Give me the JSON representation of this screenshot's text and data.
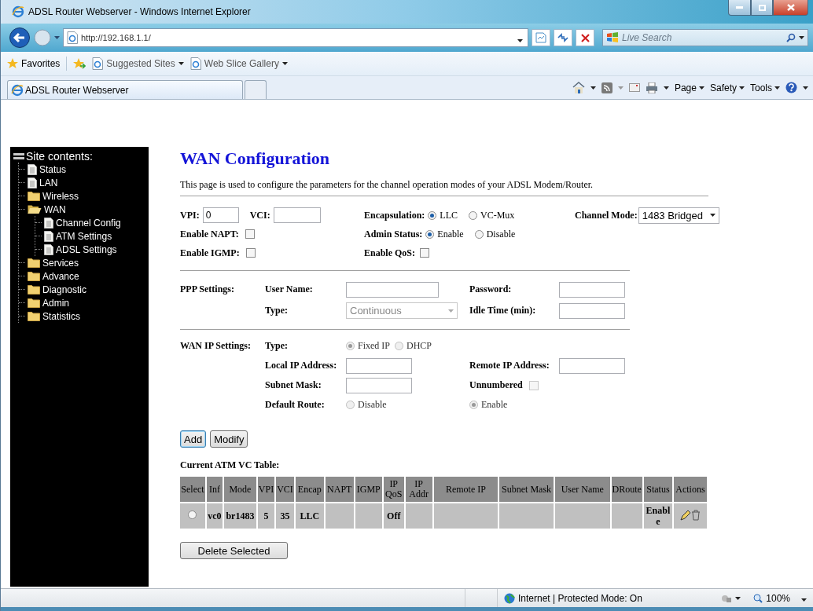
{
  "window": {
    "title": "ADSL Router Webserver - Windows Internet Explorer"
  },
  "address_bar": {
    "url": "http://192.168.1.1/"
  },
  "search": {
    "placeholder": "Live Search"
  },
  "favorites_bar": {
    "items": [
      {
        "label": "Favorites",
        "kind": "favorites"
      },
      {
        "label": "Suggested Sites",
        "kind": "link"
      },
      {
        "label": "Web Slice Gallery",
        "kind": "link"
      }
    ]
  },
  "tabs": [
    {
      "label": "ADSL Router Webserver",
      "selected": true
    }
  ],
  "command_bar": {
    "menus": [
      "Page",
      "Safety",
      "Tools"
    ]
  },
  "sidebar": {
    "title": "Site contents:",
    "items": [
      {
        "label": "Status",
        "kind": "page"
      },
      {
        "label": "LAN",
        "kind": "page"
      },
      {
        "label": "Wireless",
        "kind": "folder",
        "expanded": false
      },
      {
        "label": "WAN",
        "kind": "folder",
        "expanded": true,
        "children": [
          {
            "label": "Channel Config",
            "kind": "page"
          },
          {
            "label": "ATM Settings",
            "kind": "page"
          },
          {
            "label": "ADSL Settings",
            "kind": "page"
          }
        ]
      },
      {
        "label": "Services",
        "kind": "folder",
        "expanded": false
      },
      {
        "label": "Advance",
        "kind": "folder",
        "expanded": false
      },
      {
        "label": "Diagnostic",
        "kind": "folder",
        "expanded": false
      },
      {
        "label": "Admin",
        "kind": "folder",
        "expanded": false
      },
      {
        "label": "Statistics",
        "kind": "folder",
        "expanded": false
      }
    ]
  },
  "page": {
    "title": "WAN Configuration",
    "description": "This page is used to configure the parameters for the channel operation modes of your ADSL Modem/Router."
  },
  "form": {
    "vpi": {
      "label": "VPI:",
      "value": "0"
    },
    "vci": {
      "label": "VCI:"
    },
    "encapsulation": {
      "label": "Encapsulation:",
      "options": [
        {
          "label": "LLC",
          "selected": true
        },
        {
          "label": "VC-Mux",
          "selected": false
        }
      ]
    },
    "channel_mode": {
      "label": "Channel Mode:",
      "value": "1483 Bridged"
    },
    "enable_napt": {
      "label": "Enable NAPT:",
      "checked": false
    },
    "admin_status": {
      "label": "Admin Status:",
      "options": [
        {
          "label": "Enable",
          "selected": true
        },
        {
          "label": "Disable",
          "selected": false
        }
      ]
    },
    "enable_igmp": {
      "label": "Enable IGMP:",
      "checked": false
    },
    "enable_qos": {
      "label": "Enable QoS:",
      "checked": false
    }
  },
  "ppp": {
    "label": "PPP Settings:",
    "user_name": {
      "label": "User Name:"
    },
    "password": {
      "label": "Password:"
    },
    "type": {
      "label": "Type:",
      "value": "Continuous",
      "disabled": true
    },
    "idle_time": {
      "label": "Idle Time (min):"
    }
  },
  "wan_ip": {
    "label": "WAN IP Settings:",
    "disabled": true,
    "type": {
      "label": "Type:",
      "options": [
        {
          "label": "Fixed IP",
          "selected": true
        },
        {
          "label": "DHCP",
          "selected": false
        }
      ]
    },
    "local_ip": {
      "label": "Local IP Address:"
    },
    "remote_ip": {
      "label": "Remote IP Address:"
    },
    "subnet_mask": {
      "label": "Subnet Mask:"
    },
    "unnumbered": {
      "label": "Unnumbered",
      "checked": false
    },
    "default_route": {
      "label": "Default Route:",
      "options": [
        {
          "label": "Disable",
          "selected": false
        },
        {
          "label": "Enable",
          "selected": true
        }
      ]
    }
  },
  "buttons": [
    {
      "label": "Add",
      "focused": true
    },
    {
      "label": "Modify",
      "focused": false
    }
  ],
  "table": {
    "title": "Current ATM VC Table:",
    "columns": [
      {
        "kind": "select",
        "label": "Select"
      },
      {
        "kind": "text",
        "label": "Inf"
      },
      {
        "kind": "text",
        "label": "Mode"
      },
      {
        "kind": "text",
        "label": "VPI"
      },
      {
        "kind": "text",
        "label": "VCI"
      },
      {
        "kind": "text",
        "label": "Encap"
      },
      {
        "kind": "text",
        "label": "NAPT"
      },
      {
        "kind": "text",
        "label": "IGMP"
      },
      {
        "kind": "text",
        "label": "IP QoS"
      },
      {
        "kind": "text",
        "label": "IP Addr"
      },
      {
        "kind": "text",
        "label": "Remote IP"
      },
      {
        "kind": "text",
        "label": "Subnet Mask"
      },
      {
        "kind": "text",
        "label": "User Name"
      },
      {
        "kind": "text",
        "label": "DRoute"
      },
      {
        "kind": "text",
        "label": "Status"
      },
      {
        "kind": "actions",
        "label": "Actions"
      }
    ],
    "rows": [
      {
        "selected": false,
        "cells": [
          null,
          "vc0",
          "br1483",
          "5",
          "35",
          "LLC",
          null,
          null,
          "Off",
          null,
          null,
          null,
          null,
          null,
          "Enable",
          null
        ]
      }
    ]
  },
  "delete_button": "Delete Selected",
  "status_bar": {
    "zone": "Internet | Protected Mode: On",
    "zoom": "100%"
  }
}
